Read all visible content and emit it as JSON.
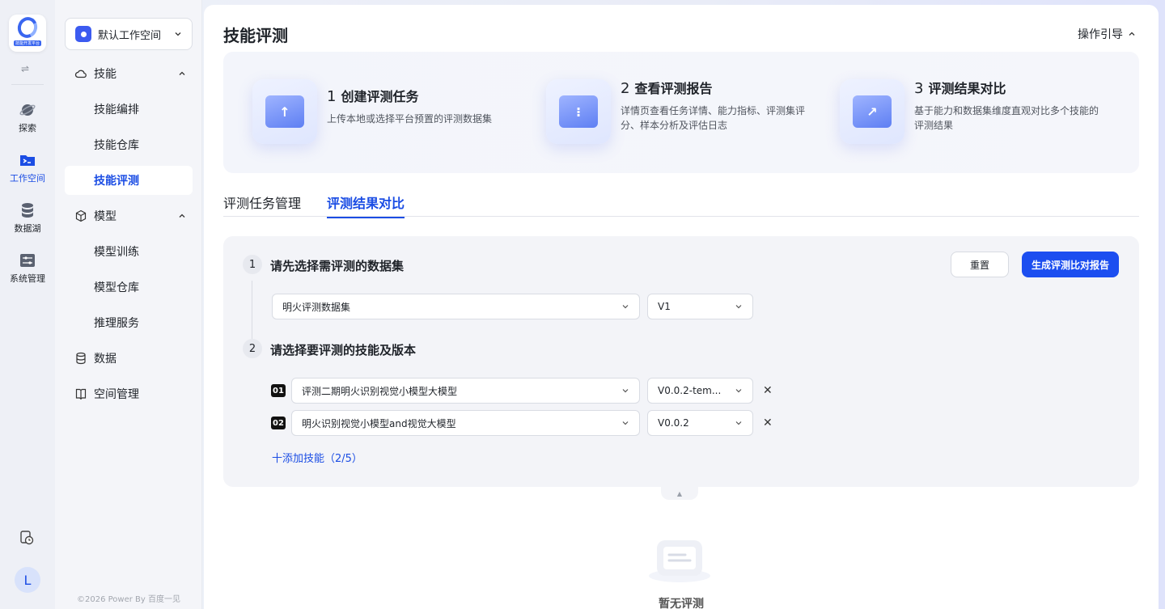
{
  "rail": {
    "logo_caption": "技能开发平台",
    "items": [
      {
        "label": "探索",
        "icon": "planet-icon"
      },
      {
        "label": "工作空间",
        "icon": "terminal-folder-icon"
      },
      {
        "label": "数据湖",
        "icon": "database-icon"
      },
      {
        "label": "系统管理",
        "icon": "settings-panel-icon"
      }
    ],
    "avatar": "L"
  },
  "sidebar": {
    "workspace": "默认工作空间",
    "items": [
      {
        "label": "技能"
      },
      {
        "label": "技能编排"
      },
      {
        "label": "技能仓库"
      },
      {
        "label": "技能评测"
      },
      {
        "label": "模型"
      },
      {
        "label": "模型训练"
      },
      {
        "label": "模型仓库"
      },
      {
        "label": "推理服务"
      },
      {
        "label": "数据"
      },
      {
        "label": "空间管理"
      }
    ],
    "copyright": "©2026 Power By 百度一见"
  },
  "page": {
    "title": "技能评测",
    "guide": "操作引导"
  },
  "steps": [
    {
      "num": "1",
      "title": "创建评测任务",
      "desc": "上传本地或选择平台预置的评测数据集"
    },
    {
      "num": "2",
      "title": "查看评测报告",
      "desc": "详情页查看任务详情、能力指标、评测集评分、样本分析及评估日志"
    },
    {
      "num": "3",
      "title": "评测结果对比",
      "desc": "基于能力和数据集维度直观对比多个技能的评测结果"
    }
  ],
  "tabs": [
    "评测任务管理",
    "评测结果对比"
  ],
  "form": {
    "step1_no": "1",
    "step1_title": "请先选择需评测的数据集",
    "dataset": "明火评测数据集",
    "dataset_version": "V1",
    "step2_no": "2",
    "step2_title": "请选择要评测的技能及版本",
    "skills": [
      {
        "badge": "01",
        "name": "评测二期明火识别视觉小模型大模型",
        "version": "V0.0.2-tem..."
      },
      {
        "badge": "02",
        "name": "明火识别视觉小模型and视觉大模型",
        "version": "V0.0.2"
      }
    ],
    "add_skill": "十添加技能（2/5）",
    "reset": "重置",
    "generate": "生成评测比对报告"
  },
  "empty": {
    "text": "暂无评测"
  },
  "colors": {
    "primary": "#1c4ef0",
    "sidebar_bg": "#f4f5f9"
  }
}
